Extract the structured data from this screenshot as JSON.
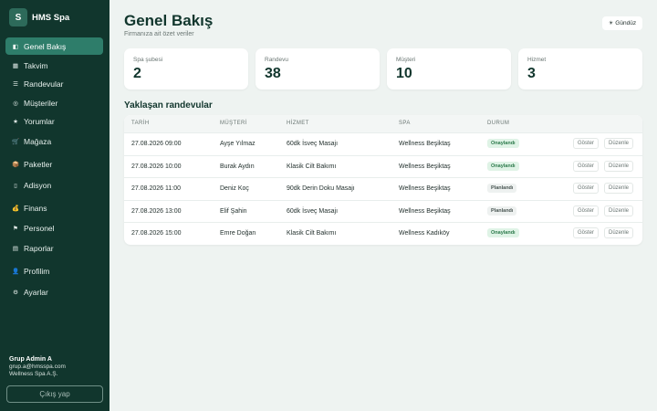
{
  "brand": {
    "logo_letter": "S",
    "name": "HMS Spa"
  },
  "nav": [
    {
      "label": "Genel Bakış",
      "icon": "dashboard-icon",
      "glyph": "◧",
      "active": true
    },
    {
      "label": "Takvim",
      "icon": "calendar-icon",
      "glyph": "▦"
    },
    {
      "label": "Randevular",
      "icon": "list-icon",
      "glyph": "☰"
    },
    {
      "label": "Müşteriler",
      "icon": "users-icon",
      "glyph": "◎"
    },
    {
      "label": "Yorumlar",
      "icon": "star-icon",
      "glyph": "★"
    },
    {
      "label": "Mağaza",
      "icon": "cart-icon",
      "glyph": "🛒"
    },
    {
      "label": "Paketler",
      "icon": "package-icon",
      "glyph": "📦"
    },
    {
      "label": "Adisyon",
      "icon": "receipt-icon",
      "glyph": "▯"
    },
    {
      "label": "Finans",
      "icon": "money-icon",
      "glyph": "💰"
    },
    {
      "label": "Personel",
      "icon": "staff-icon",
      "glyph": "⚑"
    },
    {
      "label": "Raporlar",
      "icon": "chart-icon",
      "glyph": "▤"
    },
    {
      "label": "Profilim",
      "icon": "profile-icon",
      "glyph": "👤"
    },
    {
      "label": "Ayarlar",
      "icon": "settings-icon",
      "glyph": "⚙"
    }
  ],
  "user": {
    "name": "Grup Admin A",
    "email": "grup.a@hmsspa.com",
    "company": "Wellness Spa A.Ş.",
    "logout_label": "Çıkış yap"
  },
  "header": {
    "title": "Genel Bakış",
    "subtitle": "Firmanıza ait özet veriler",
    "theme_label": "Gündüz",
    "theme_glyph": "☀"
  },
  "stats": [
    {
      "label": "Spa şubesi",
      "value": "2"
    },
    {
      "label": "Randevu",
      "value": "38"
    },
    {
      "label": "Müşteri",
      "value": "10"
    },
    {
      "label": "Hizmet",
      "value": "3"
    }
  ],
  "upcoming": {
    "title": "Yaklaşan randevular",
    "columns": [
      "TARİH",
      "MÜŞTERİ",
      "HİZMET",
      "SPA",
      "DURUM"
    ],
    "actions": {
      "show": "Göster",
      "edit": "Düzenle"
    },
    "rows": [
      {
        "date": "27.08.2026 09:00",
        "customer": "Ayşe Yılmaz",
        "service": "60dk İsveç Masajı",
        "spa": "Wellness Beşiktaş",
        "status": "Onaylandı",
        "status_type": "ok"
      },
      {
        "date": "27.08.2026 10:00",
        "customer": "Burak Aydın",
        "service": "Klasik Cilt Bakımı",
        "spa": "Wellness Beşiktaş",
        "status": "Onaylandı",
        "status_type": "ok"
      },
      {
        "date": "27.08.2026 11:00",
        "customer": "Deniz Koç",
        "service": "90dk Derin Doku Masajı",
        "spa": "Wellness Beşiktaş",
        "status": "Planlandı",
        "status_type": "plan"
      },
      {
        "date": "27.08.2026 13:00",
        "customer": "Elif Şahin",
        "service": "60dk İsveç Masajı",
        "spa": "Wellness Beşiktaş",
        "status": "Planlandı",
        "status_type": "plan"
      },
      {
        "date": "27.08.2026 15:00",
        "customer": "Emre Doğan",
        "service": "Klasik Cilt Bakımı",
        "spa": "Wellness Kadıköy",
        "status": "Onaylandı",
        "status_type": "ok"
      }
    ]
  },
  "colors": {
    "sidebar_bg": "#11362d",
    "accent": "#2e7d6a",
    "page_bg": "#eef3f1",
    "confirmed_badge": "#dff3e6",
    "planned_badge": "#eef1f0"
  }
}
